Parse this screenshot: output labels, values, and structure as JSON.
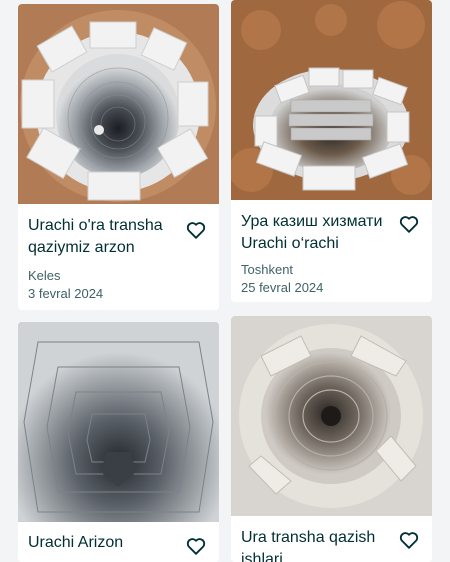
{
  "listings": [
    {
      "title": "Urachi o'ra transha qaziymiz arzon",
      "location": "Keles",
      "date": "3 fevral 2024"
    },
    {
      "title": "Ура казиш хизмати Urachi o‘rachi",
      "location": "Toshkent",
      "date": "25 fevral 2024"
    },
    {
      "title": "Urachi Arizon",
      "location": "",
      "date": ""
    },
    {
      "title": "Ura transha qazish ishlari",
      "location": "",
      "date": ""
    }
  ],
  "icons": {
    "favorite": "heart-outline-icon"
  }
}
